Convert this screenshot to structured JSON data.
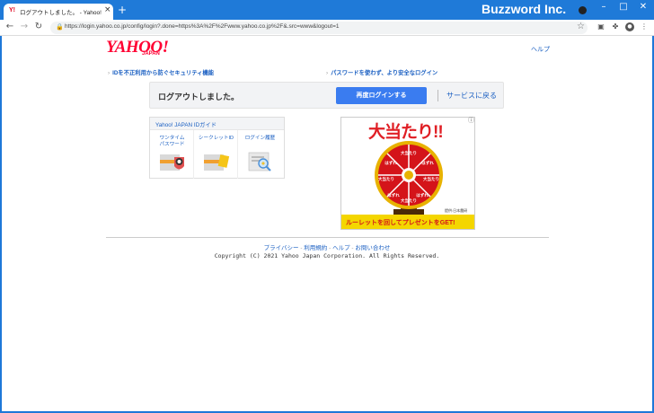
{
  "browser": {
    "tab_favicon": "Y!",
    "tab_title": "ログアウトしました。 - Yahoo! JAPAN",
    "brand": "Buzzword Inc.",
    "url": "https://login.yahoo.co.jp/config/login?.done=https%3A%2F%2Fwww.yahoo.co.jp%2F&.src=www&logout=1",
    "icons": [
      "back-icon",
      "forward-icon",
      "reload-icon",
      "lock-icon",
      "star-icon",
      "extension-icon",
      "puzzle-icon",
      "profile-icon",
      "menu-icon"
    ]
  },
  "header": {
    "logo_main": "YAHOO!",
    "logo_sub": "JAPAN",
    "help": "ヘルプ"
  },
  "features": {
    "left": "IDを不正利用から防ぐセキュリティ機能",
    "right": "パスワードを使わず、より安全なログイン"
  },
  "logout": {
    "message": "ログアウトしました。",
    "relogin_button": "再度ログインする",
    "back_link": "サービスに戻る"
  },
  "guide": {
    "title": "Yahoo! JAPAN IDガイド",
    "items": [
      {
        "label": "ワンタイム\nパスワード",
        "icon": "onetime-password-icon"
      },
      {
        "label": "シークレットID",
        "icon": "secret-id-icon"
      },
      {
        "label": "ログイン履歴",
        "icon": "login-history-icon"
      }
    ]
  },
  "ad": {
    "headline": "大当たり!!",
    "footer": "ルーレットを回してプレゼントをGET!",
    "sponsor": "提供:日本農研",
    "wheel_segments": [
      "大当たり",
      "はずれ",
      "大当たり",
      "はずれ",
      "大当たり",
      "はずれ",
      "大当たり",
      "はずれ"
    ],
    "colors": {
      "red": "#d4141a",
      "yellow": "#f4d600",
      "gold": "#e8b200"
    }
  },
  "footer": {
    "links": [
      "プライバシー",
      "利用規約",
      "ヘルプ",
      "お問い合わせ"
    ],
    "separator": " - ",
    "copyright": "Copyright (C) 2021 Yahoo Japan Corporation. All Rights Reserved."
  },
  "colors": {
    "titlebar": "#1f7ad8",
    "link": "#1a5fc2",
    "primary_button": "#3a7cf0",
    "yahoo_red": "#ff0033"
  }
}
